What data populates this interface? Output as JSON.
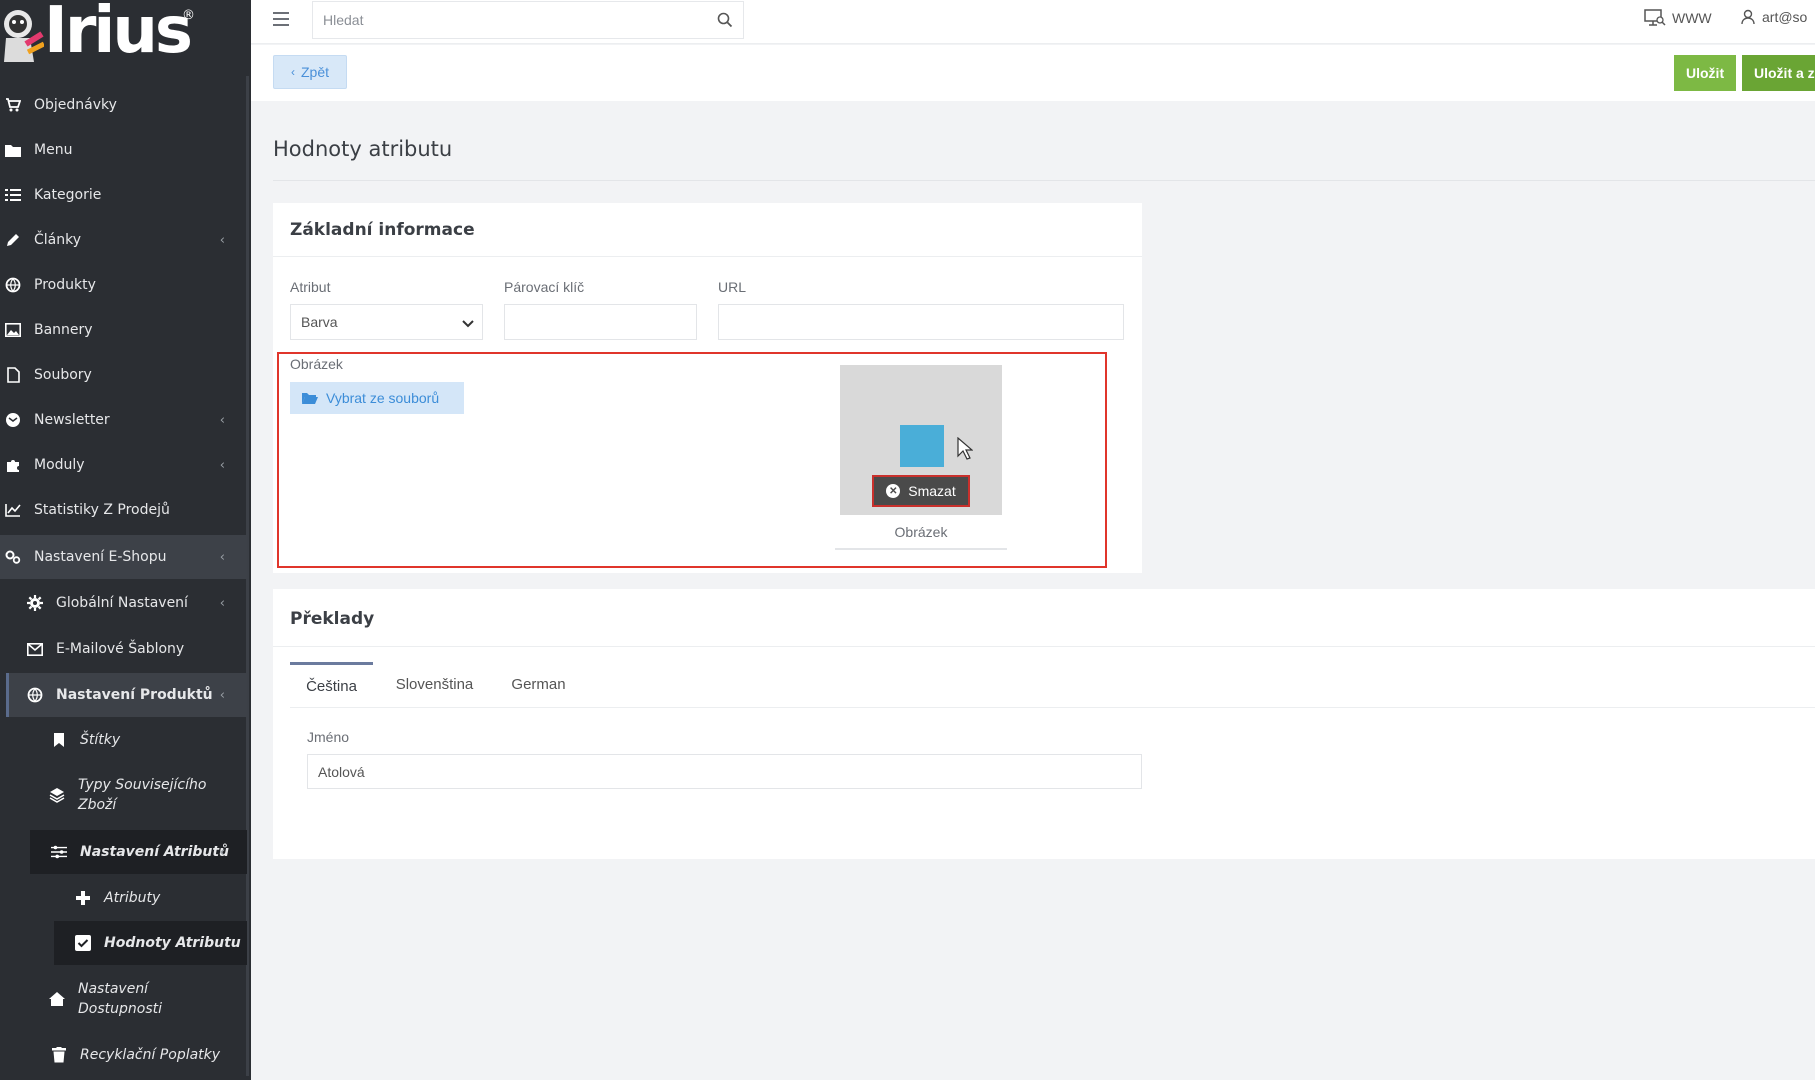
{
  "brand": {
    "logo_text": "Irius",
    "logo_mark": "®"
  },
  "search": {
    "placeholder": "Hledat"
  },
  "topbar": {
    "www_label": "WWW",
    "user_label": "art@so"
  },
  "actions": {
    "back_label": "Zpět",
    "save_label": "Uložit",
    "save_close_label": "Uložit a zav"
  },
  "sidebar": {
    "items": [
      {
        "label": "Objednávky",
        "icon": "cart-icon"
      },
      {
        "label": "Menu",
        "icon": "folder-icon"
      },
      {
        "label": "Kategorie",
        "icon": "list-icon"
      },
      {
        "label": "Články",
        "icon": "pencil-icon"
      },
      {
        "label": "Produkty",
        "icon": "ball-icon"
      },
      {
        "label": "Bannery",
        "icon": "image-icon"
      },
      {
        "label": "Soubory",
        "icon": "file-icon"
      },
      {
        "label": "Newsletter",
        "icon": "envelope-icon"
      },
      {
        "label": "Moduly",
        "icon": "puzzle-icon"
      },
      {
        "label": "Statistiky Z Prodejů",
        "icon": "chart-icon"
      },
      {
        "label": "Nastavení E-Shopu",
        "icon": "cogs-icon"
      },
      {
        "label": "Globální Nastavení",
        "icon": "gear-icon"
      },
      {
        "label": "E-Mailové Šablony",
        "icon": "mail-icon"
      },
      {
        "label": "Nastavení Produktů",
        "icon": "ball-icon"
      },
      {
        "label": "Štítky",
        "icon": "bookmark-icon"
      },
      {
        "label": "Typy Souvisejícího Zboží",
        "icon": "layers-icon"
      },
      {
        "label": "Nastavení Atributů",
        "icon": "sliders-icon"
      },
      {
        "label": "Atributy",
        "icon": "plus-icon"
      },
      {
        "label": "Hodnoty Atributu",
        "icon": "checkbox-icon"
      },
      {
        "label": "Nastavení Dostupnosti",
        "icon": "home-icon"
      },
      {
        "label": "Recyklační Poplatky",
        "icon": "trash-icon"
      }
    ]
  },
  "page": {
    "title": "Hodnoty atributu"
  },
  "basic_info": {
    "header": "Základní informace",
    "attribute_label": "Atribut",
    "attribute_value": "Barva",
    "pairing_key_label": "Párovací klíč",
    "pairing_key_value": "",
    "url_label": "URL",
    "url_value": "",
    "image_label": "Obrázek",
    "choose_file_label": "Vybrat ze souborů",
    "delete_label": "Smazat",
    "image_caption": "Obrázek",
    "swatch_color": "#4aaed8"
  },
  "translations": {
    "header": "Překlady",
    "tabs": [
      "Čeština",
      "Slovenština",
      "German"
    ],
    "active_tab": "Čeština",
    "name_label": "Jméno",
    "name_value": "Atolová"
  }
}
